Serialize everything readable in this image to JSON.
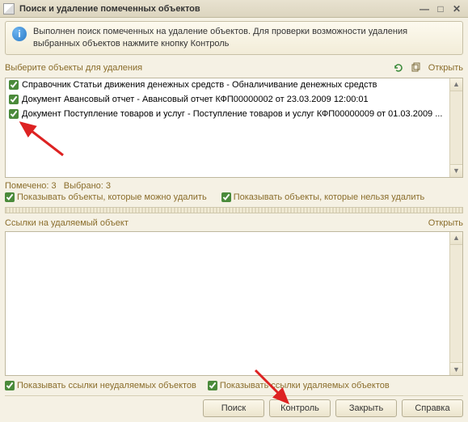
{
  "titlebar": {
    "title": "Поиск и удаление помеченных объектов"
  },
  "info": {
    "text": "Выполнен поиск помеченных на удаление объектов. Для проверки возможности удаления выбранных объектов нажмите кнопку Контроль"
  },
  "selectSection": {
    "label": "Выберите объекты для удаления",
    "openLink": "Открыть"
  },
  "items": [
    {
      "checked": true,
      "label": "Справочник Статьи движения денежных средств - Обналичивание денежных средств"
    },
    {
      "checked": true,
      "label": "Документ Авансовый отчет - Авансовый отчет КФП00000002 от 23.03.2009 12:00:01"
    },
    {
      "checked": true,
      "label": "Документ Поступление товаров и услуг - Поступление товаров и услуг КФП00000009 от 01.03.2009 ..."
    }
  ],
  "counts": {
    "markedLabel": "Помечено:",
    "marked": "3",
    "selectedLabel": "Выбрано:",
    "selected": "3"
  },
  "filterChecks": {
    "canDelete": "Показывать объекты, которые можно удалить",
    "cannotDelete": "Показывать объекты, которые нельзя удалить"
  },
  "refSection": {
    "label": "Ссылки на удаляемый объект",
    "openLink": "Открыть"
  },
  "bottomChecks": {
    "showUndeletable": "Показывать ссылки неудаляемых объектов",
    "showDeletable": "Показывать ссылки удаляемых объектов"
  },
  "buttons": {
    "search": "Поиск",
    "control": "Контроль",
    "close": "Закрыть",
    "help": "Справка"
  }
}
